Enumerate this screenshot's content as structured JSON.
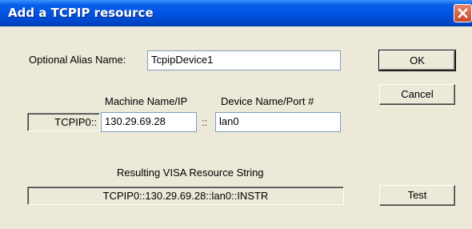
{
  "window": {
    "title": "Add a TCPIP resource"
  },
  "alias": {
    "label": "Optional Alias Name:",
    "value": "TcpipDevice1"
  },
  "machine": {
    "label": "Machine Name/IP",
    "prefix": "TCPIP0::",
    "value": "130.29.69.28",
    "separator": "::"
  },
  "device": {
    "label": "Device Name/Port #",
    "value": "lan0"
  },
  "resource": {
    "label": "Resulting VISA Resource String",
    "value": "TCPIP0::130.29.69.28::lan0::INSTR"
  },
  "buttons": {
    "ok": "OK",
    "cancel": "Cancel",
    "test": "Test"
  }
}
